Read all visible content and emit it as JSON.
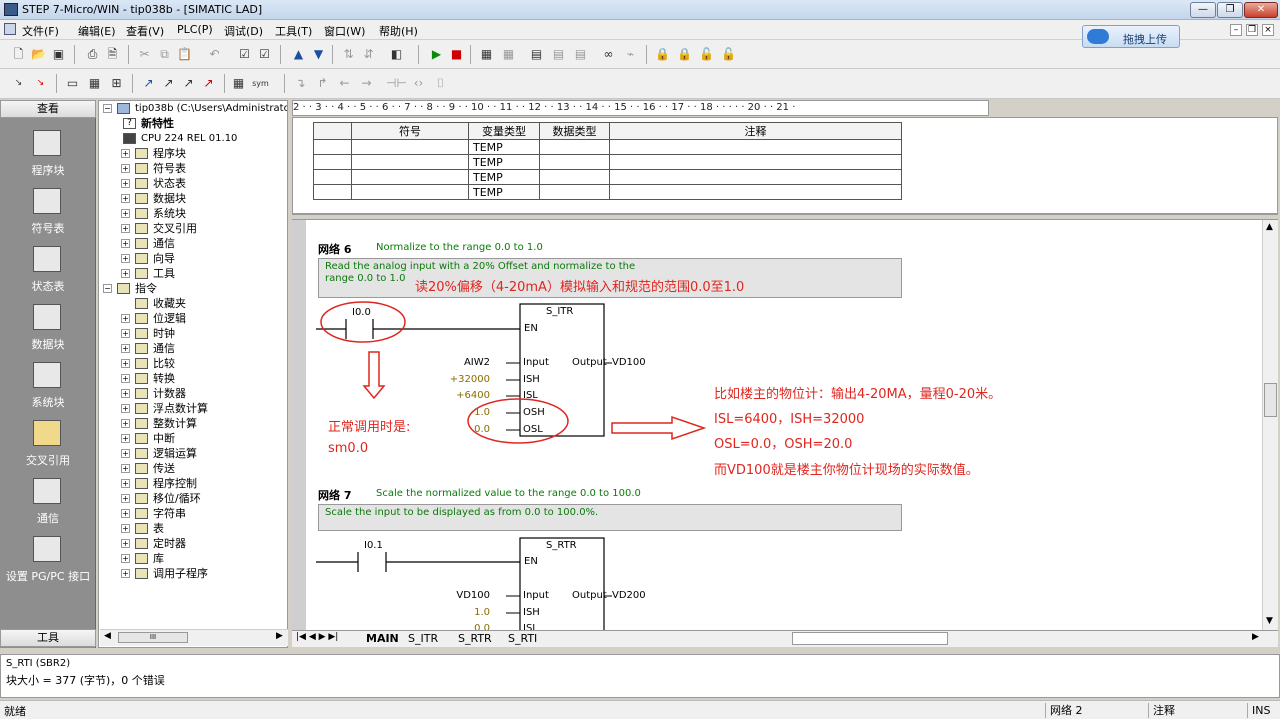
{
  "window": {
    "title": "STEP 7-Micro/WIN - tip038b - [SIMATIC LAD]"
  },
  "menu": [
    "文件(F)",
    "编辑(E)",
    "查看(V)",
    "PLC(P)",
    "调试(D)",
    "工具(T)",
    "窗口(W)",
    "帮助(H)"
  ],
  "upload_button": "拖拽上传",
  "nav": {
    "header": "查看",
    "items": [
      "程序块",
      "符号表",
      "状态表",
      "数据块",
      "系统块",
      "交叉引用",
      "通信",
      "设置 PG/PC 接口"
    ],
    "footer": "工具"
  },
  "tree": {
    "root": "tip038b (C:\\Users\\Administrator\\D",
    "new_features": "新特性",
    "cpu": "CPU 224 REL 01.10",
    "project_items": [
      "程序块",
      "符号表",
      "状态表",
      "数据块",
      "系统块",
      "交叉引用",
      "通信",
      "向导",
      "工具"
    ],
    "instructions": "指令",
    "instruction_items": [
      "收藏夹",
      "位逻辑",
      "时钟",
      "通信",
      "比较",
      "转换",
      "计数器",
      "浮点数计算",
      "整数计算",
      "中断",
      "逻辑运算",
      "传送",
      "程序控制",
      "移位/循环",
      "字符串",
      "表",
      "定时器",
      "库",
      "调用子程序"
    ],
    "scroll_mark": "III"
  },
  "ruler": "2 · · 3 · · 4 · · 5 · · 6 · · 7 · · 8 · · 9 · · 10 · · 11 · · 12 · · 13 · · 14 · · 15 · · 16 · · 17 · · 18 · · · · · 20 · · 21 ·",
  "var_table": {
    "headers": [
      "",
      "符号",
      "变量类型",
      "数据类型",
      "注释"
    ],
    "rows": [
      "TEMP",
      "TEMP",
      "TEMP",
      "TEMP"
    ]
  },
  "network6": {
    "label": "网络 6",
    "comment": "Normalize to the range 0.0 to 1.0",
    "box_line1": "Read the analog input with a 20% Offset and normalize to the",
    "box_line2": "range  0.0 to 1.0",
    "contact": "I0.0",
    "block": "S_ITR",
    "en": "EN",
    "pins": [
      "Input",
      "ISH",
      "ISL",
      "OSH",
      "OSL"
    ],
    "pin_values": [
      "AIW2",
      "+32000",
      "+6400",
      "1.0",
      "0.0"
    ],
    "out_pin": "Output",
    "out_value": "VD100"
  },
  "network7": {
    "label": "网络 7",
    "comment": "Scale the normalized value to the range 0.0 to 100.0",
    "box": "Scale the input to be displayed as from 0.0 to 100.0%.",
    "contact": "I0.1",
    "block": "S_RTR",
    "en": "EN",
    "pins": [
      "Input",
      "ISH",
      "ISL"
    ],
    "pin_values": [
      "VD100",
      "1.0",
      "0.0"
    ],
    "out_pin": "Output",
    "out_value": "VD200"
  },
  "annotations": {
    "title": "读20%偏移（4-20mA）模拟输入和规范的范围0.0至1.0",
    "call1": "正常调用时是:",
    "call2": "sm0.0",
    "ex1": "比如楼主的物位计：输出4-20MA，量程0-20米。",
    "ex2": "ISL=6400，ISH=32000",
    "ex3": "OSL=0.0，OSH=20.0",
    "ex4": "而VD100就是楼主你物位计现场的实际数值。",
    "color": "#e0261f"
  },
  "tabs": [
    "MAIN",
    "S_ITR",
    "S_RTR",
    "S_RTI"
  ],
  "messages": {
    "line1": "S_RTI (SBR2)",
    "line2": "块大小 = 377 (字节)，0 个错误"
  },
  "status": {
    "ready": "就绪",
    "network": "网络 2",
    "comment": "注释",
    "mode": "INS"
  }
}
